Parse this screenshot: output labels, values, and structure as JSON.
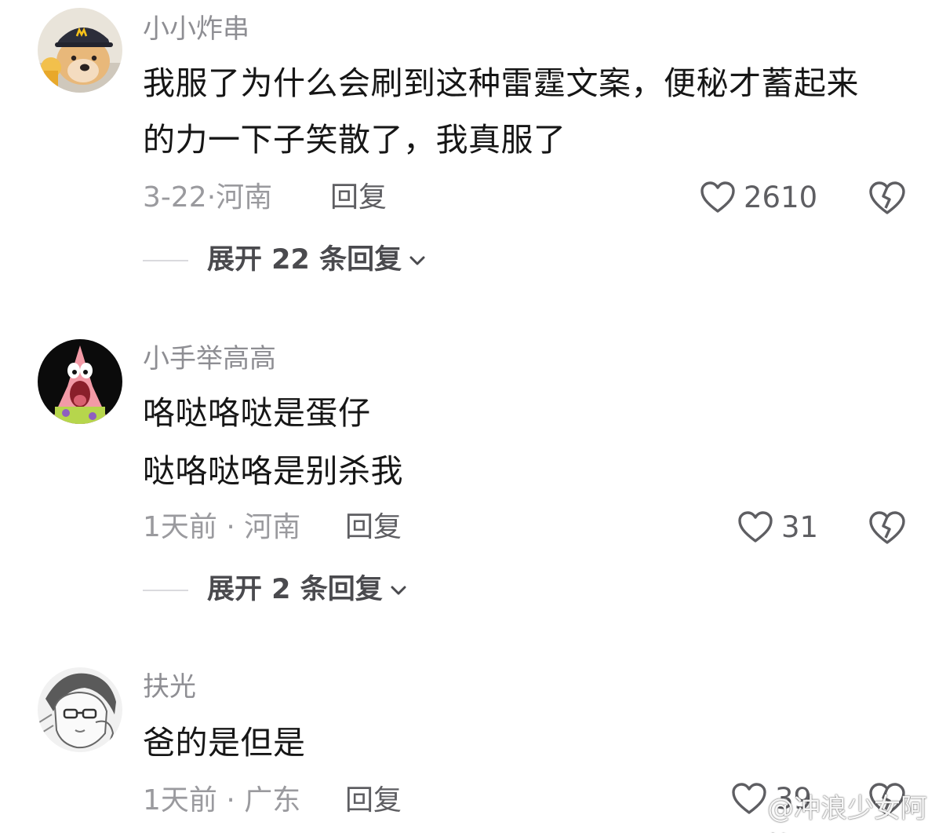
{
  "comments": [
    {
      "username": "小小炸串",
      "lines": [
        "我服了为什么会刷到这种雷霆文案，便秘才蓄起来",
        "的力一下子笑散了，我真服了"
      ],
      "date": "3-22",
      "location": "河南",
      "reply_label": "回复",
      "likes": "2610",
      "expand_label": "展开 22 条回复",
      "avatar_icon": "dog-with-cap-avatar"
    },
    {
      "username": "小手举高高",
      "lines": [
        "咯哒咯哒是蛋仔",
        "哒咯哒咯是别杀我"
      ],
      "date": "1天前",
      "location": "河南",
      "reply_label": "回复",
      "likes": "31",
      "expand_label": "展开 2 条回复",
      "avatar_icon": "patrick-star-avatar"
    },
    {
      "username": "扶光",
      "lines": [
        "爸的是但是"
      ],
      "date": "1天前",
      "location": "广东",
      "reply_label": "回复",
      "likes": "39",
      "avatar_icon": "anime-sketch-avatar"
    }
  ],
  "watermark": {
    "text": "@冲浪少女阿怡",
    "icon": "weibo-logo-icon"
  },
  "colors": {
    "username": "#8e8e93",
    "content": "#161616",
    "meta": "#9a9a9e",
    "action": "#5e5e62"
  }
}
